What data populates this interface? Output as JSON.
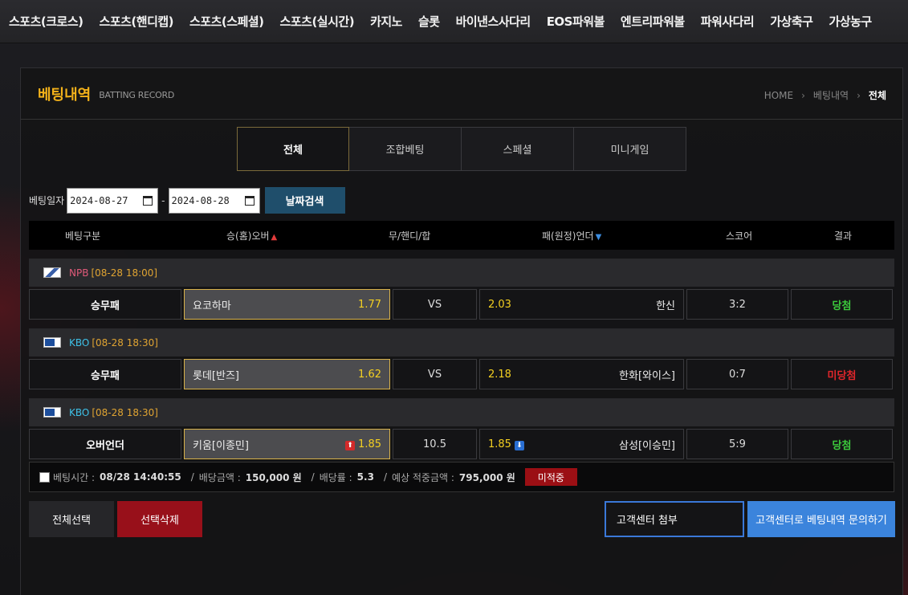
{
  "nav": {
    "items": [
      "스포츠(크로스)",
      "스포츠(핸디캡)",
      "스포츠(스페셜)",
      "스포츠(실시간)",
      "카지노",
      "슬롯",
      "바이낸스사다리",
      "EOS파워볼",
      "엔트리파워볼",
      "파워사다리",
      "가상축구",
      "가상농구"
    ]
  },
  "header": {
    "title": "베팅내역",
    "subtitle": "BATTING RECORD",
    "breadcrumb": [
      "HOME",
      "베팅내역",
      "전체"
    ]
  },
  "tabs": [
    {
      "label": "전체",
      "active": true
    },
    {
      "label": "조합베팅",
      "active": false
    },
    {
      "label": "스페셜",
      "active": false
    },
    {
      "label": "미니게임",
      "active": false
    }
  ],
  "date_filter": {
    "label": "베팅일자",
    "from": "2024-08-27",
    "to": "2024-08-28",
    "search_label": "날짜검색"
  },
  "table_header": {
    "type": "베팅구분",
    "home": "승(홈)오버",
    "mid": "무/핸디/합",
    "away": "패(원정)언더",
    "score": "스코어",
    "result": "결과"
  },
  "bets": [
    {
      "league": "NPB",
      "league_color": "#e05a7a",
      "time": "[08-28 18:00]",
      "type": "승무패",
      "home": "요코하마",
      "home_odds": "1.77",
      "mid": "VS",
      "away_odds": "2.03",
      "away": "한신",
      "score": "3:2",
      "result": "당첨",
      "result_color": "#3cc93c"
    },
    {
      "league": "KBO",
      "league_color": "#3ec1e8",
      "time": "[08-28 18:30]",
      "type": "승무패",
      "home": "롯데[반즈]",
      "home_odds": "1.62",
      "mid": "VS",
      "away_odds": "2.18",
      "away": "한화[와이스]",
      "score": "0:7",
      "result": "미당첨",
      "result_color": "#e0262b"
    },
    {
      "league": "KBO",
      "league_color": "#3ec1e8",
      "time": "[08-28 18:30]",
      "type": "오버언더",
      "home": "키움[이종민]",
      "home_odds": "1.85",
      "mid": "10.5",
      "away_odds": "1.85",
      "away": "삼성[이승민]",
      "score": "5:9",
      "result": "당첨",
      "result_color": "#3cc93c"
    }
  ],
  "summary": {
    "time_label": "베팅시간 :",
    "time": "08/28 14:40:55",
    "amount_label": "배당금액 :",
    "amount": "150,000 원",
    "rate_label": "배당률 :",
    "rate": "5.3",
    "expected_label": "예상 적중금액 :",
    "expected": "795,000 원",
    "status": "미적중"
  },
  "buttons": {
    "select_all": "전체선택",
    "delete_selected": "선택삭제",
    "attach": "고객센터 첨부",
    "inquire": "고객센터로 베팅내역 문의하기"
  }
}
